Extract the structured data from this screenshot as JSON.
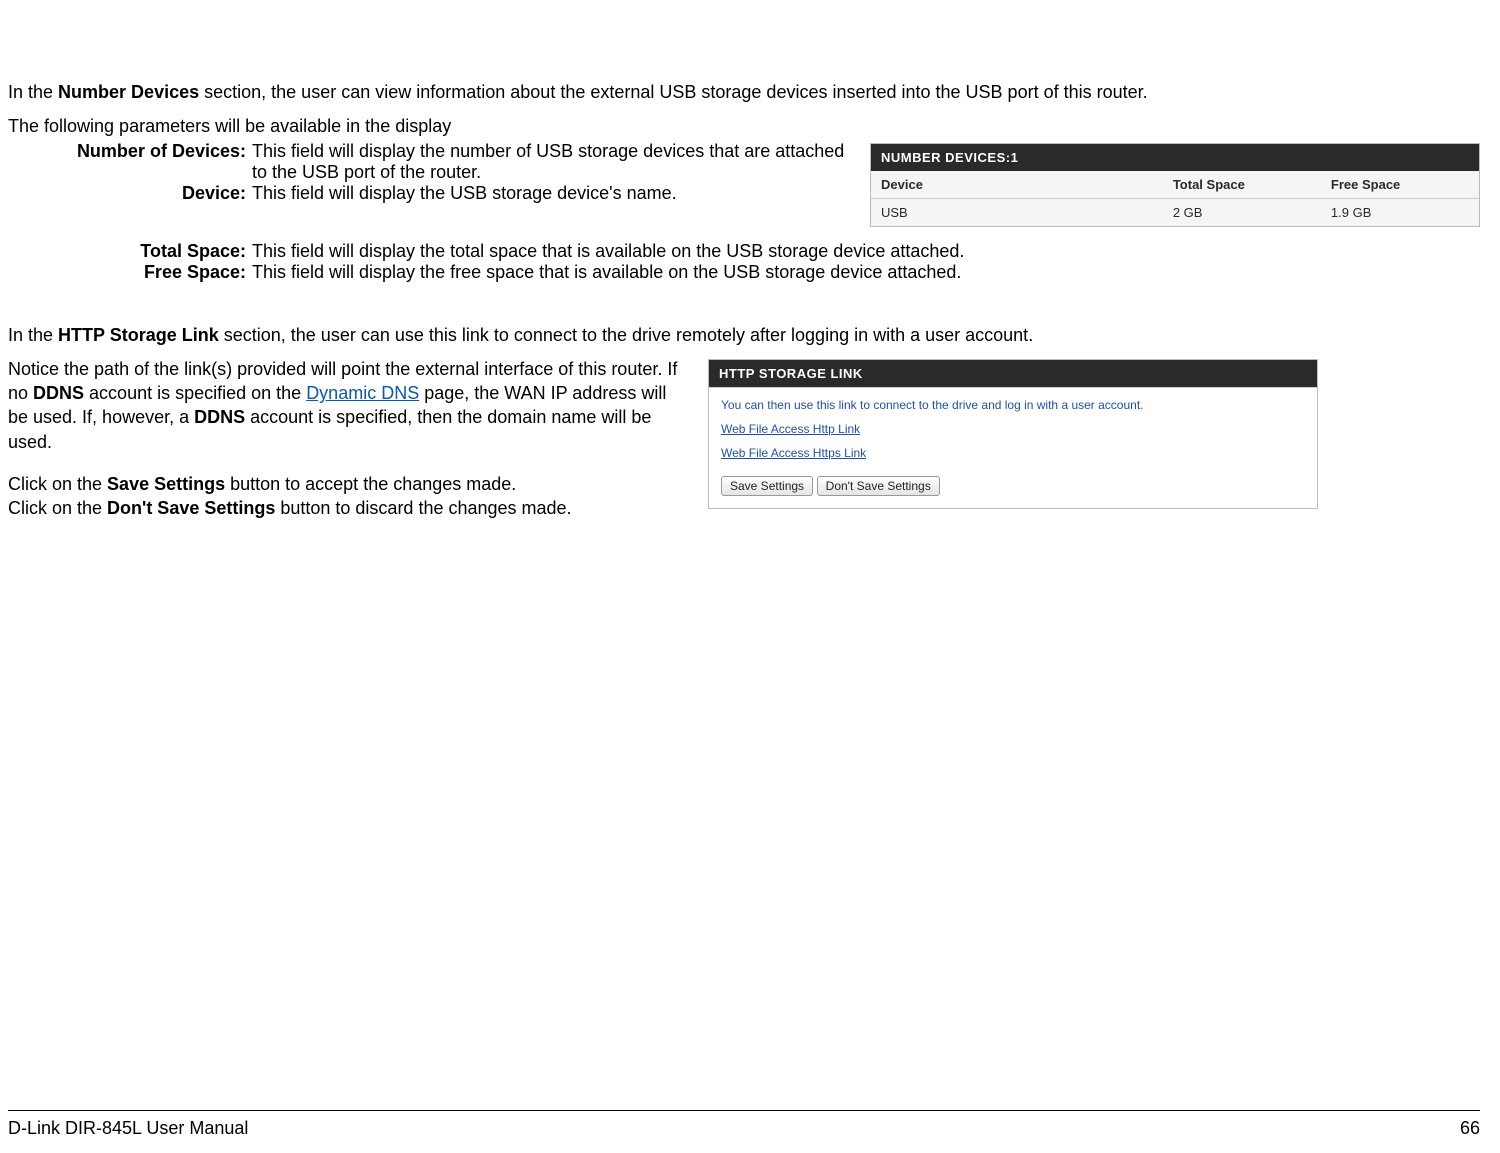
{
  "intro1_a": "In the ",
  "intro1_bold": "Number Devices",
  "intro1_b": " section, the user can view information about the external USB storage devices inserted into the USB port of this router.",
  "intro2": "The following parameters will be available in the display",
  "defs": {
    "numdev_label": "Number of Devices:",
    "numdev_text": "This field will display the number of USB storage devices that are attached to the USB port of the router.",
    "device_label": "Device:",
    "device_text": "This field will display the USB storage device's name.",
    "total_label": "Total Space:",
    "total_text": "This field will display the total space that is available on the USB storage device attached.",
    "free_label": "Free Space:",
    "free_text": "This field will display the free space that is available on the USB storage device attached."
  },
  "panel1": {
    "title": "NUMBER DEVICES:1",
    "col1": "Device",
    "col2": "Total Space",
    "col3": "Free Space",
    "row1": {
      "device": "USB",
      "total": "2 GB",
      "free": "1.9 GB"
    }
  },
  "intro3_a": "In the ",
  "intro3_bold": "HTTP Storage Link",
  "intro3_b": " section, the user can use this link to connect to the drive remotely after logging in with a user account.",
  "notice_a": "Notice the path of the link(s) provided will point the external interface of this router. If no ",
  "notice_ddns1": "DDNS",
  "notice_b": " account is specified on the  ",
  "notice_link": "Dynamic DNS",
  "notice_c": " page, the WAN IP address will be used. If, however, a ",
  "notice_ddns2": "DDNS",
  "notice_d": " account is specified, then the domain name will be used.",
  "save_a": "Click on the ",
  "save_bold": "Save Settings",
  "save_b": " button to accept the changes made.",
  "dont_a": "Click on the ",
  "dont_bold": "Don't Save Settings",
  "dont_b": " button to discard the changes made.",
  "panel2": {
    "title": "HTTP STORAGE LINK",
    "desc": "You can then use this link to connect to the drive and log in with a user account.",
    "link1": "Web File Access Http Link",
    "link2": "Web File Access Https Link",
    "btn_save": "Save Settings",
    "btn_dont": "Don't Save Settings"
  },
  "footer": {
    "left": "D-Link DIR-845L User Manual",
    "right": "66"
  }
}
